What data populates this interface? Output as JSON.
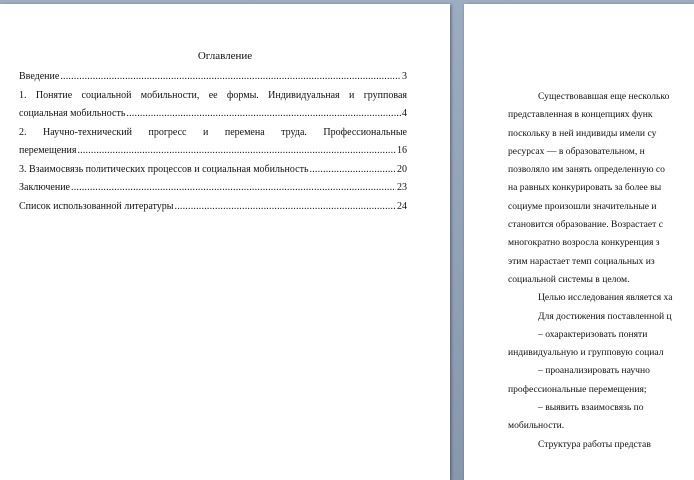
{
  "toc": {
    "title": "Оглавление",
    "entries": [
      {
        "line1": "Введение",
        "page": "3"
      },
      {
        "line1": "1. Понятие социальной мобильности, ее формы. Индивидуальная и групповая",
        "line2": "социальная мобильность",
        "page": "4"
      },
      {
        "line1": "2. Научно-технический прогресс и перемена труда. Профессиональные",
        "line2": "перемещения",
        "page": "16"
      },
      {
        "line1": "3. Взаимосвязь политических процессов и социальная мобильность",
        "page": "20"
      },
      {
        "line1": "Заключение",
        "page": "23"
      },
      {
        "line1": "Список использованной литературы",
        "page": "24"
      }
    ]
  },
  "body": {
    "lines": [
      "Существовавшая еще несколько",
      "представленная в концепциях функ",
      "поскольку в ней индивиды имели су",
      "ресурсах — в образовательном, н",
      "позволяло им занять определенную со",
      "на равных конкурировать за более вы",
      "социуме произошли значительные и",
      "становится образование. Возрастает с",
      "многократно возросла конкуренция з",
      "этим нарастает темп социальных из",
      "социальной системы в целом.",
      "Целью исследования является ха",
      "Для достижения поставленной ц",
      "–     охарактеризовать поняти",
      "индивидуальную и групповую социал",
      "–     проанализировать научно",
      "профессиональные перемещения;",
      "–     выявить взаимосвязь по",
      "мобильности.",
      "Структура работы представ"
    ]
  }
}
